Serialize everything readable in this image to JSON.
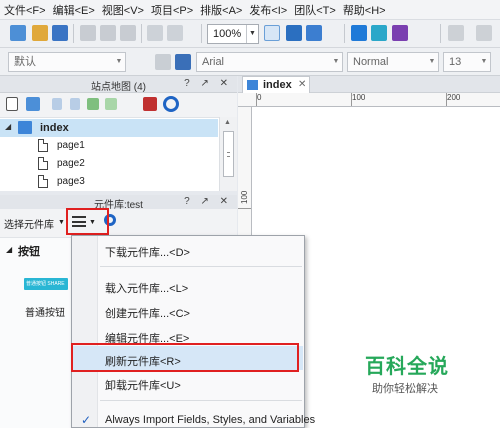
{
  "menubar": {
    "items": [
      "文件<F>",
      "编辑<E>",
      "视图<V>",
      "项目<P>",
      "排版<A>",
      "发布<I>",
      "团队<T>",
      "帮助<H>"
    ]
  },
  "toolbar": {
    "zoom": "100%"
  },
  "format_bar": {
    "style": "默认",
    "font": "Arial",
    "weight": "Normal",
    "size": "13"
  },
  "sitemap": {
    "title": "站点地图 (4)",
    "header_controls": "? ↗ ✕",
    "pages": [
      "index",
      "page1",
      "page2",
      "page3"
    ]
  },
  "library": {
    "title": "元件库:test",
    "header_controls": "? ↗ ✕",
    "select_label": "选择元件库",
    "group_name": "按钮",
    "widget_label": "普通按钮",
    "widget_thumb_text": "普通按钮 SHARE"
  },
  "canvas": {
    "tab_label": "index",
    "ruler_top": [
      "0",
      "100",
      "200"
    ],
    "ruler_left": [
      "100"
    ]
  },
  "dropdown_menu": {
    "items": [
      "下载元件库...<D>",
      "载入元件库...<L>",
      "创建元件库...<C>",
      "编辑元件库...<E>",
      "刷新元件库<R>",
      "卸载元件库<U>",
      "Always Import Fields, Styles, and Variables"
    ],
    "check_mark": "✓"
  },
  "watermark": {
    "title": "百科全说",
    "subtitle": "助你轻松解决"
  },
  "colors": {
    "highlight_box": "#e02020",
    "selection": "#c9e3f6",
    "accent_blue": "#1f7ad8"
  }
}
